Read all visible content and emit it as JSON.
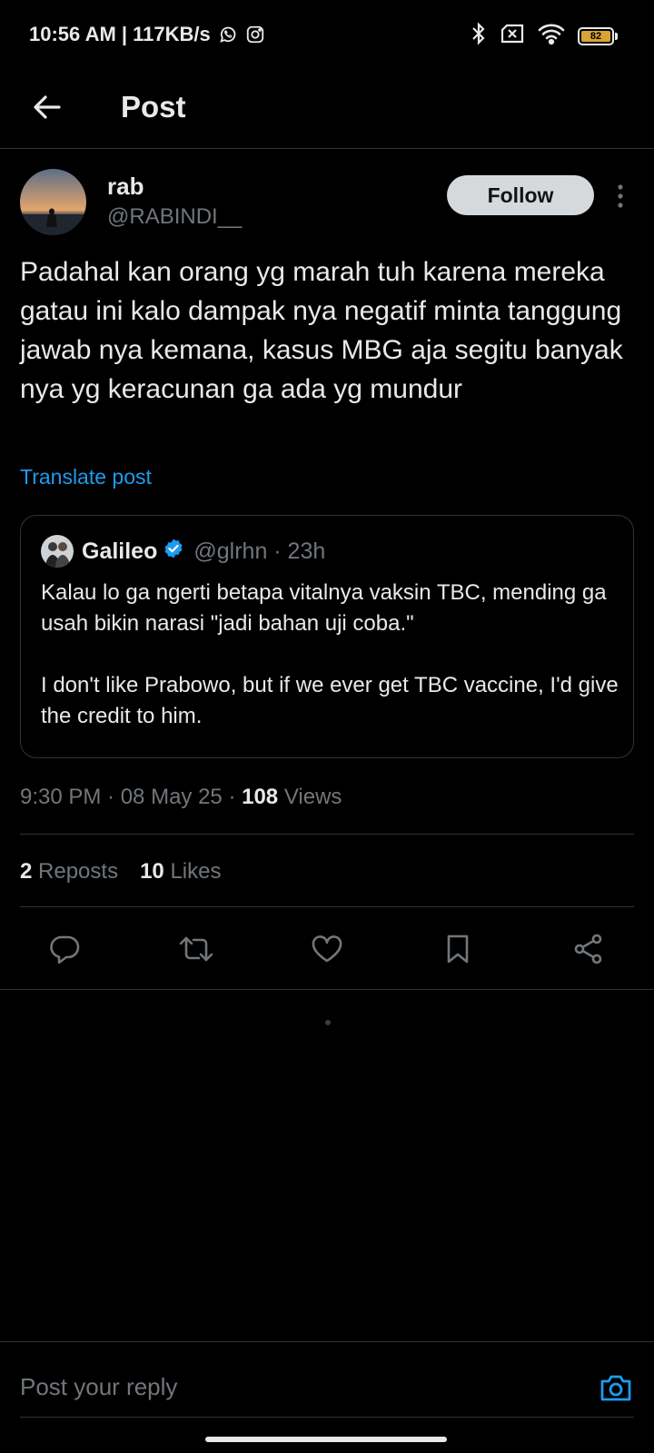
{
  "status_bar": {
    "time_speed": "10:56 AM | 117KB/s",
    "battery_level": "82",
    "icons": [
      "whatsapp-icon",
      "instagram-icon",
      "bluetooth-icon",
      "sim-x-icon",
      "wifi-icon",
      "battery-icon"
    ]
  },
  "header": {
    "title": "Post"
  },
  "post": {
    "display_name": "rab",
    "handle": "@RABINDI__",
    "follow_label": "Follow",
    "text": "Padahal kan orang yg marah tuh karena mereka gatau ini kalo dampak nya negatif minta tanggung jawab nya kemana, kasus MBG aja segitu banyak nya yg keracunan ga ada yg mundur",
    "translate_label": "Translate post",
    "quote": {
      "name": "Galileo",
      "handle_time": "@glrhn · 23h",
      "text": "Kalau lo ga ngerti betapa vitalnya vaksin TBC, mending ga usah bikin narasi \"jadi bahan uji coba.\"\n\nI don't like Prabowo, but if we ever get TBC vaccine, I'd give the credit to him."
    },
    "timestamp": "9:30 PM · 08 May 25 · ",
    "views_count": "108",
    "views_label": " Views",
    "reposts_count": "2",
    "reposts_label": " Reposts",
    "likes_count": "10",
    "likes_label": " Likes"
  },
  "reply": {
    "placeholder": "Post your reply"
  },
  "colors": {
    "accent": "#1d9bf0",
    "background": "#000000",
    "muted": "#71767b",
    "divider": "#2f3336"
  }
}
